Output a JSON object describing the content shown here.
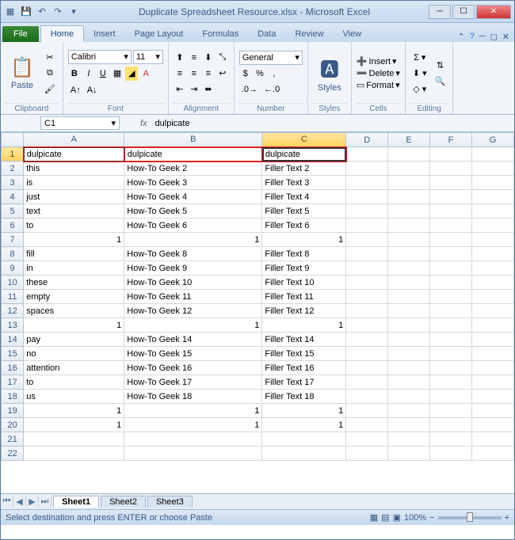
{
  "title": "Duplicate Spreadsheet Resource.xlsx  -  Microsoft Excel",
  "tabs": {
    "file": "File",
    "home": "Home",
    "insert": "Insert",
    "pageLayout": "Page Layout",
    "formulas": "Formulas",
    "data": "Data",
    "review": "Review",
    "view": "View"
  },
  "ribbon": {
    "clipboard": {
      "paste": "Paste",
      "label": "Clipboard"
    },
    "font": {
      "name": "Calibri",
      "size": "11",
      "label": "Font"
    },
    "alignment": {
      "label": "Alignment"
    },
    "number": {
      "format": "General",
      "label": "Number"
    },
    "styles": {
      "btn": "Styles",
      "label": "Styles"
    },
    "cells": {
      "insert": "Insert",
      "delete": "Delete",
      "format": "Format",
      "label": "Cells"
    },
    "editing": {
      "label": "Editing"
    }
  },
  "namebox": "C1",
  "formula": "dulpicate",
  "columns": [
    "A",
    "B",
    "C",
    "D",
    "E",
    "F",
    "G"
  ],
  "rows": [
    {
      "n": 1,
      "A": "dulpicate",
      "B": "dulpicate",
      "C": "dulpicate"
    },
    {
      "n": 2,
      "A": "this",
      "B": "How-To Geek  2",
      "C": "Filler Text 2"
    },
    {
      "n": 3,
      "A": "is",
      "B": "How-To Geek  3",
      "C": "Filler Text 3"
    },
    {
      "n": 4,
      "A": "just",
      "B": "How-To Geek  4",
      "C": "Filler Text 4"
    },
    {
      "n": 5,
      "A": "text",
      "B": "How-To Geek  5",
      "C": "Filler Text 5"
    },
    {
      "n": 6,
      "A": "to",
      "B": "How-To Geek  6",
      "C": "Filler Text 6"
    },
    {
      "n": 7,
      "A": "1",
      "B": "1",
      "C": "1",
      "num": true
    },
    {
      "n": 8,
      "A": "fill",
      "B": "How-To Geek  8",
      "C": "Filler Text 8"
    },
    {
      "n": 9,
      "A": "in",
      "B": "How-To Geek  9",
      "C": "Filler Text 9"
    },
    {
      "n": 10,
      "A": "these",
      "B": "How-To Geek  10",
      "C": "Filler Text 10"
    },
    {
      "n": 11,
      "A": "empty",
      "B": "How-To Geek  11",
      "C": "Filler Text 11"
    },
    {
      "n": 12,
      "A": "spaces",
      "B": "How-To Geek  12",
      "C": "Filler Text 12"
    },
    {
      "n": 13,
      "A": "1",
      "B": "1",
      "C": "1",
      "num": true
    },
    {
      "n": 14,
      "A": "pay",
      "B": "How-To Geek  14",
      "C": "Filler Text 14"
    },
    {
      "n": 15,
      "A": "no",
      "B": "How-To Geek  15",
      "C": "Filler Text 15"
    },
    {
      "n": 16,
      "A": "attention",
      "B": "How-To Geek  16",
      "C": "Filler Text 16"
    },
    {
      "n": 17,
      "A": "to",
      "B": "How-To Geek  17",
      "C": "Filler Text 17"
    },
    {
      "n": 18,
      "A": "us",
      "B": "How-To Geek  18",
      "C": "Filler Text 18"
    },
    {
      "n": 19,
      "A": "1",
      "B": "1",
      "C": "1",
      "num": true
    },
    {
      "n": 20,
      "A": "1",
      "B": "1",
      "C": "1",
      "num": true
    },
    {
      "n": 21,
      "A": "",
      "B": "",
      "C": ""
    },
    {
      "n": 22,
      "A": "",
      "B": "",
      "C": ""
    }
  ],
  "sheets": [
    "Sheet1",
    "Sheet2",
    "Sheet3"
  ],
  "status": "Select destination and press ENTER or choose Paste",
  "zoom": "100%"
}
